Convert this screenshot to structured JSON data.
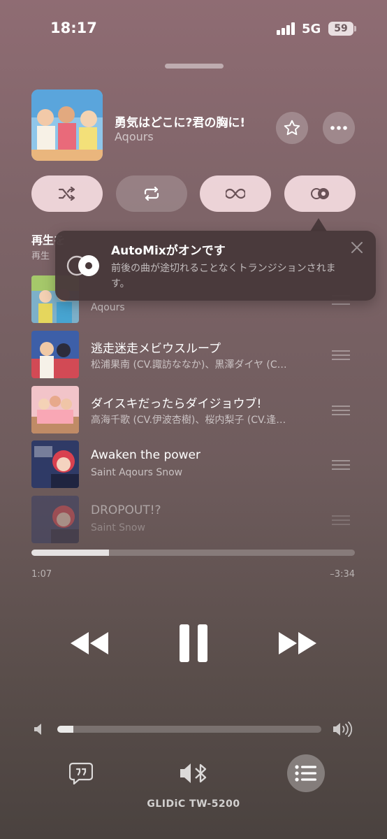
{
  "status": {
    "time": "18:17",
    "network": "5G",
    "battery": "59"
  },
  "now_playing": {
    "title": "勇気はどこに?君の胸に!",
    "artist": "Aqours"
  },
  "section": {
    "heading": "再生を",
    "subheading": "再生"
  },
  "tooltip": {
    "title": "AutoMixがオンです",
    "description": "前後の曲が途切れることなくトランジションされます。"
  },
  "queue": [
    {
      "title": "",
      "artist": "Aqours"
    },
    {
      "title": "逃走迷走メビウスループ",
      "artist": "松浦果南 (CV.諏訪ななか)、黒澤ダイヤ (C…"
    },
    {
      "title": "ダイスキだったらダイジョウブ!",
      "artist": "高海千歌 (CV.伊波杏樹)、桜内梨子 (CV.逢…"
    },
    {
      "title": "Awaken the power",
      "artist": "Saint Aqours Snow"
    },
    {
      "title": "DROPOUT!?",
      "artist": "Saint Snow"
    }
  ],
  "playback": {
    "elapsed": "1:07",
    "remaining": "–3:34",
    "progress_fraction": 0.24
  },
  "volume": {
    "level_fraction": 0.06
  },
  "output": {
    "device": "GLIDiC TW-5200"
  },
  "icons": [
    "star-icon",
    "more-icon",
    "shuffle-icon",
    "repeat-icon",
    "infinity-icon",
    "automix-icon",
    "close-icon",
    "drag-handle-icon",
    "rewind-icon",
    "pause-icon",
    "fast-forward-icon",
    "volume-low-icon",
    "volume-high-icon",
    "lyrics-icon",
    "bluetooth-speaker-icon",
    "queue-list-icon"
  ],
  "colors": {
    "accent_pill": "#ffe6eb",
    "tooltip_bg": "#48383a"
  }
}
